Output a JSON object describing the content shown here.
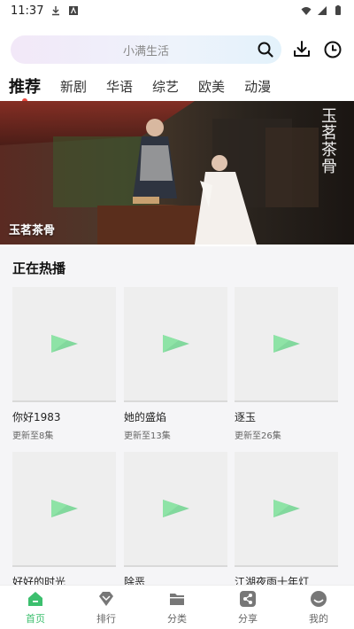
{
  "status_bar": {
    "time": "11:37"
  },
  "search": {
    "placeholder": "小满生活"
  },
  "tabs": [
    {
      "label": "推荐",
      "active": true
    },
    {
      "label": "新剧",
      "active": false
    },
    {
      "label": "华语",
      "active": false
    },
    {
      "label": "综艺",
      "active": false
    },
    {
      "label": "欧美",
      "active": false
    },
    {
      "label": "动漫",
      "active": false
    }
  ],
  "banner": {
    "title": "玉茗茶骨",
    "logo_text": "玉茗茶骨"
  },
  "hot": {
    "heading": "正在热播",
    "items": [
      {
        "title": "你好1983",
        "subtitle": "更新至8集"
      },
      {
        "title": "她的盛焰",
        "subtitle": "更新至13集"
      },
      {
        "title": "逐玉",
        "subtitle": "更新至26集"
      },
      {
        "title": "好好的时光",
        "subtitle": ""
      },
      {
        "title": "除恶",
        "subtitle": ""
      },
      {
        "title": "江湖夜雨十年灯",
        "subtitle": ""
      }
    ]
  },
  "bottom_nav": [
    {
      "label": "首页",
      "icon": "home-icon",
      "active": true
    },
    {
      "label": "排行",
      "icon": "rank-icon",
      "active": false
    },
    {
      "label": "分类",
      "icon": "folder-icon",
      "active": false
    },
    {
      "label": "分享",
      "icon": "share-icon",
      "active": false
    },
    {
      "label": "我的",
      "icon": "profile-icon",
      "active": false
    }
  ],
  "colors": {
    "accent": "#3cbf6e",
    "tab_dot": "#e8453c",
    "play_icon": "#6fd38e"
  }
}
